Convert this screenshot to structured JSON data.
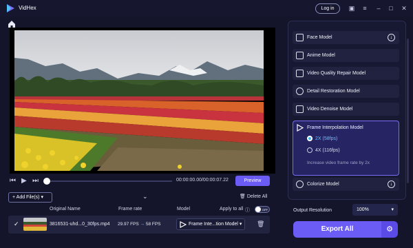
{
  "app": {
    "name": "VidHex",
    "login_label": "Log in"
  },
  "titlebar": {
    "icons": [
      "message-icon",
      "menu-icon",
      "minimize-icon",
      "maximize-icon",
      "close-icon"
    ]
  },
  "player": {
    "time": "00:00:00.00/00:00:07.22",
    "preview_label": "Preview",
    "progress": 0
  },
  "toolbar": {
    "add_files_label": "Add File(s)",
    "delete_all_label": "Delete All"
  },
  "table": {
    "headers": {
      "original_name": "Original Name",
      "frame_rate": "Frame rate",
      "model": "Model",
      "apply_to_all": "Apply to all"
    },
    "toggle_label": "OFF",
    "rows": [
      {
        "name": "3816531-uhd...0_30fps.mp4",
        "fps_from": "29.97 FPS",
        "fps_to": "58 FPS",
        "model": "Frame Inte...tion Model"
      }
    ]
  },
  "models": [
    {
      "label": "Face Model",
      "download": true
    },
    {
      "label": "Anime Model",
      "download": false
    },
    {
      "label": "Video Quality Repair Model",
      "download": false
    },
    {
      "label": "Detail Restoration Model",
      "download": false
    },
    {
      "label": "Video Denoise Model",
      "download": false
    }
  ],
  "frame_interpolation": {
    "label": "Frame Interpolation Model",
    "options": [
      "2X (58fps)",
      "4X (116fps)"
    ],
    "selected": 0,
    "description": "Increase video frame rate by 2x"
  },
  "colorize": {
    "label": "Colorize Model"
  },
  "output": {
    "label": "Output Resolution",
    "value": "100%"
  },
  "export_label": "Export All",
  "colors": {
    "accent": "#6b5cf6",
    "background": "#14152b",
    "panel": "#171832"
  }
}
